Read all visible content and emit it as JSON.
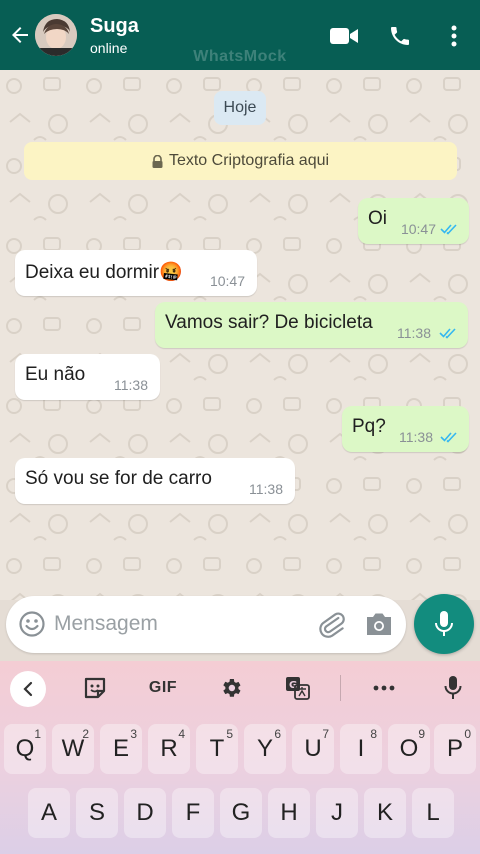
{
  "header": {
    "contact_name": "Suga",
    "contact_status": "online",
    "watermark": "WhatsMock",
    "icons": [
      "back-arrow-icon",
      "video-call-icon",
      "phone-icon",
      "more-vert-icon"
    ]
  },
  "chat": {
    "date_chip": "Hoje",
    "encryption_notice": "Texto Criptografia aqui",
    "messages": [
      {
        "direction": "out",
        "text": "Oi",
        "time": "10:47",
        "status": "read"
      },
      {
        "direction": "in",
        "text": "Deixa eu dormir🤬",
        "time": "10:47"
      },
      {
        "direction": "out",
        "text": "Vamos sair? De bicicleta",
        "time": "11:38",
        "status": "read"
      },
      {
        "direction": "in",
        "text": "Eu não",
        "time": "11:38"
      },
      {
        "direction": "out",
        "text": "Pq?",
        "time": "11:38",
        "status": "read"
      },
      {
        "direction": "in",
        "text": "Só vou se for de carro",
        "time": "11:38"
      }
    ]
  },
  "composer": {
    "placeholder": "Mensagem"
  },
  "keyboard": {
    "toolbar": {
      "gif_label": "GIF"
    },
    "row1": [
      {
        "key": "Q",
        "alt": "1"
      },
      {
        "key": "W",
        "alt": "2"
      },
      {
        "key": "E",
        "alt": "3"
      },
      {
        "key": "R",
        "alt": "4"
      },
      {
        "key": "T",
        "alt": "5"
      },
      {
        "key": "Y",
        "alt": "6"
      },
      {
        "key": "U",
        "alt": "7"
      },
      {
        "key": "I",
        "alt": "8"
      },
      {
        "key": "O",
        "alt": "9"
      },
      {
        "key": "P",
        "alt": "0"
      }
    ],
    "row2": [
      "A",
      "S",
      "D",
      "F",
      "G",
      "H",
      "J",
      "K",
      "L"
    ]
  },
  "colors": {
    "header": "#075e54",
    "outgoing_bubble": "#dcf8c6",
    "incoming_bubble": "#ffffff",
    "read_ticks": "#34b7f1",
    "mic_button": "#128c7e",
    "encryption_banner": "#fcf4c4"
  }
}
